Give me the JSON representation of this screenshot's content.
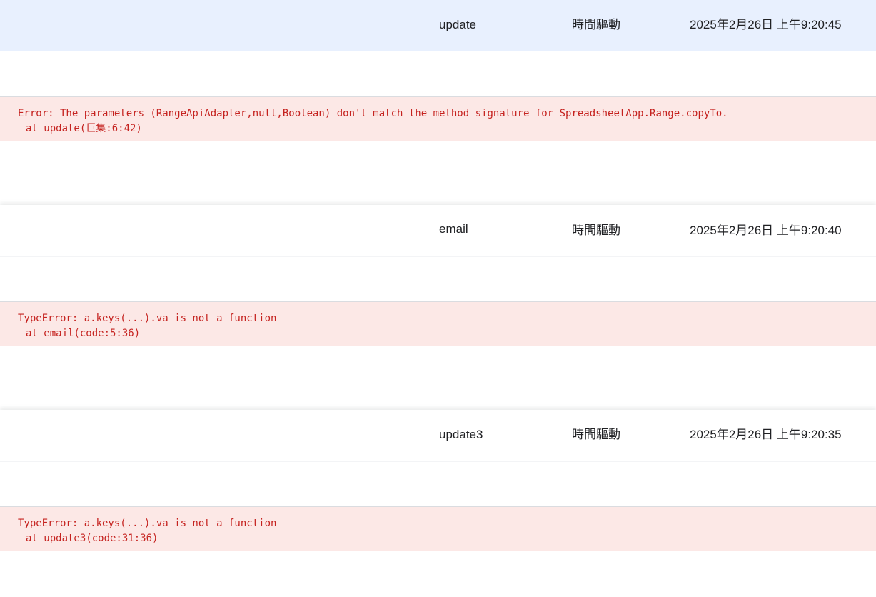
{
  "executions": [
    {
      "function": "update",
      "trigger": "時間驅動",
      "start_time": "2025年2月26日 上午9:20:45",
      "error_line1": "Error: The parameters (RangeApiAdapter,null,Boolean) don't match the method signature for SpreadsheetApp.Range.copyTo.",
      "error_line2": "at update(巨集:6:42)",
      "selected": true
    },
    {
      "function": "email",
      "trigger": "時間驅動",
      "start_time": "2025年2月26日 上午9:20:40",
      "error_line1": "TypeError: a.keys(...).va is not a function",
      "error_line2": "at email(code:5:36)",
      "selected": false
    },
    {
      "function": "update3",
      "trigger": "時間驅動",
      "start_time": "2025年2月26日 上午9:20:35",
      "error_line1": "TypeError: a.keys(...).va is not a function",
      "error_line2": "at update3(code:31:36)",
      "selected": false
    }
  ],
  "colors": {
    "selected_row": "#e8f0fe",
    "error_background": "#fce8e6",
    "error_text": "#c5221f",
    "text": "#202124"
  }
}
